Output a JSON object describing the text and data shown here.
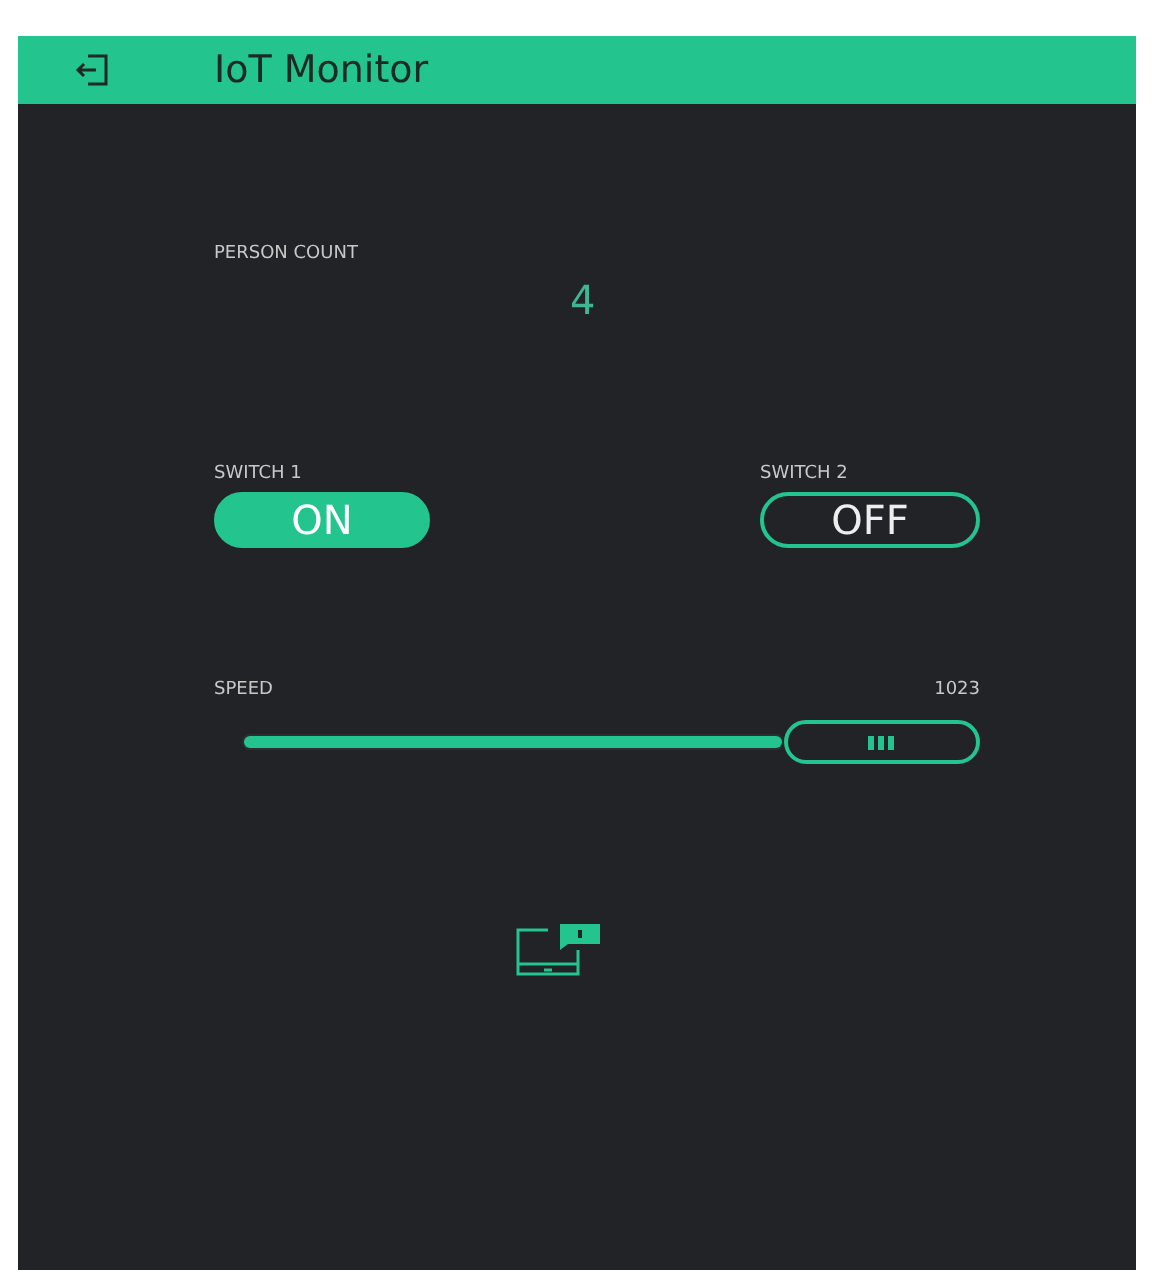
{
  "header": {
    "title": "IoT Monitor"
  },
  "person_count": {
    "label": "PERSON COUNT",
    "value": "4"
  },
  "switches": [
    {
      "label": "SWITCH 1",
      "text": "ON",
      "on": true
    },
    {
      "label": "SWITCH 2",
      "text": "OFF",
      "on": false
    }
  ],
  "slider": {
    "label": "SPEED",
    "reading": "1023",
    "level": 1.0
  }
}
